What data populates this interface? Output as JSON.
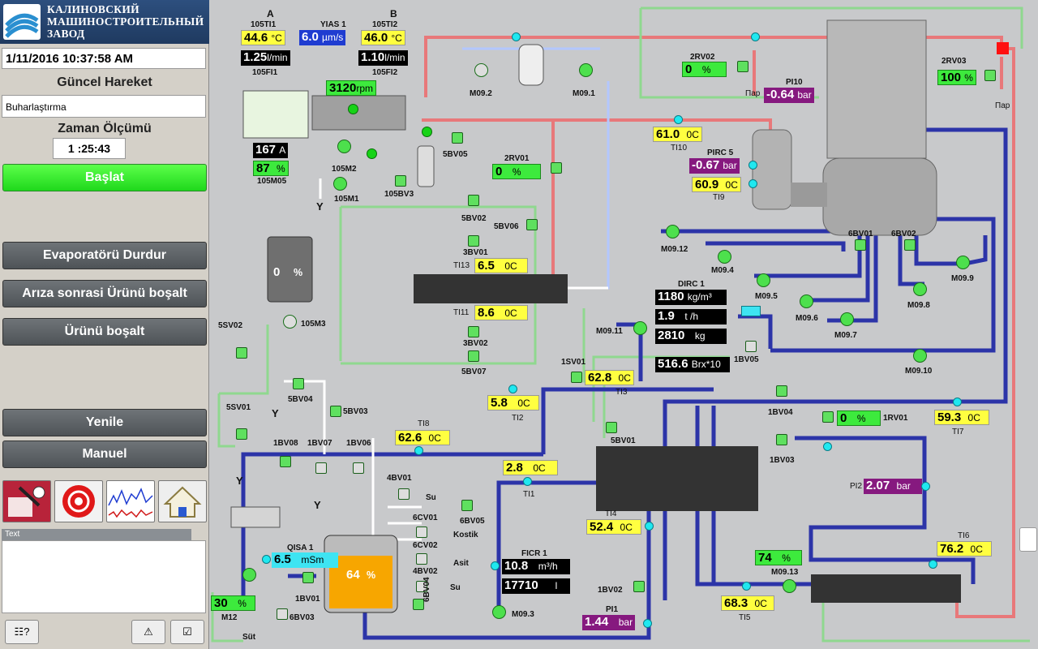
{
  "logo": {
    "line1": "КАЛИНОВСКИЙ",
    "line2": "МАШИНОСТРОИТЕЛЬНЫЙ",
    "line3": "ЗАВОД"
  },
  "sidebar": {
    "datetime": "1/11/2016 10:37:58 AM",
    "current_move_label": "Güncel Hareket",
    "current_move_value": "Buharlaştırma",
    "timer_label": "Zaman Ölçümü",
    "timer_value": "1  :25:43",
    "start_button": "Başlat",
    "stop_evap_button": "Evaporatörü Durdur",
    "empty_after_fault_button": "Arıza sonrasi Ürünü boşalt",
    "empty_product_button": "Ürünü boşalt",
    "refresh_button": "Yenile",
    "manual_button": "Manuel",
    "text_header": "Text",
    "tool_icons": [
      "operator-icon",
      "alarm-icon",
      "trend-icon",
      "home-icon"
    ]
  },
  "tags": {
    "A": "A",
    "B": "B",
    "ti1_label": "105TI1",
    "ti1_val": "44.6",
    "ti1_unit": "°C",
    "yias_label": "YIAS 1",
    "yias_val": "6.0",
    "yias_unit": "µm/s",
    "ti2_label": "105TI2",
    "ti2_val": "46.0",
    "ti2_unit": "°C",
    "fi1_val": "1.25",
    "fi1_unit": "l/min",
    "fi1_label": "105FI1",
    "fi2_val": "1.10",
    "fi2_unit": "l/min",
    "fi2_label": "105FI2",
    "rpm_val": "3120",
    "rpm_unit": "rpm",
    "amp_val": "167",
    "amp_unit": "A",
    "m05_val": "87",
    "m05_unit": "%",
    "m05_label": "105M05",
    "m2_label": "105M2",
    "m1_label": "105M1",
    "bv3_label": "105BV3",
    "bv05_label": "5BV05",
    "m092_label": "M09.2",
    "m091_label": "M09.1",
    "rv01_label": "2RV01",
    "rv01_val": "0",
    "rv01_unit": "%",
    "rv02_label": "2RV02",
    "rv02_val": "0",
    "rv02_unit": "%",
    "rv03_label": "2RV03",
    "rv03_val": "100",
    "rv03_unit": "%",
    "par1": "Пар",
    "par2": "Пар",
    "pi10_label": "PI10",
    "pi10_val": "-0.64",
    "pi10_unit": "bar",
    "ti10_val": "61.0",
    "ti10_unit": "0C",
    "ti10_label": "TI10",
    "pirc5_label": "PIRC 5",
    "pirc5_val": "-0.67",
    "pirc5_unit": "bar",
    "ti9_val": "60.9",
    "ti9_unit": "0C",
    "ti9_label": "TI9",
    "y1": "Y",
    "y2": "Y",
    "y3": "Y",
    "y4": "Y",
    "bv02_label": "5BV02",
    "bv06_label": "5BV06",
    "bv3_01": "3BV01",
    "ti13_label": "TI13",
    "ti13_val": "6.5",
    "ti13_unit": "0C",
    "ti11_label": "TI11",
    "ti11_val": "8.6",
    "ti11_unit": "0C",
    "bv3_02": "3BV02",
    "bv07_label": "5BV07",
    "tank_val": "0",
    "tank_unit": "%",
    "m3_label": "105M3",
    "sv02_label": "5SV02",
    "bv04_label": "5BV04",
    "bv03_label": "5BV03",
    "sv01_label": "5SV01",
    "m0912_label": "M09.12",
    "m094_label": "M09.4",
    "m095_label": "M09.5",
    "m096_label": "M09.6",
    "m097_label": "M09.7",
    "m098_label": "M09.8",
    "m099_label": "M09.9",
    "m0910_label": "M09.10",
    "m0911_label": "M09.11",
    "bv6_01": "6BV01",
    "bv6_02": "6BV02",
    "dirc_label": "DIRC 1",
    "dirc_dens": "1180",
    "dirc_dens_unit": "kg/m³",
    "dirc_flow": "1.9",
    "dirc_flow_unit": "t /h",
    "dirc_mass": "2810",
    "dirc_mass_unit": "kg",
    "brix_val": "516.6",
    "brix_unit": "Brx*10",
    "bv05_1": "1BV05",
    "sv1_label": "1SV01",
    "ti3_val": "62.8",
    "ti3_unit": "0C",
    "ti3_label": "TI3",
    "ti2b_val": "5.8",
    "ti2b_unit": "0C",
    "ti2b_label": "TI2",
    "ti8_label": "TI8",
    "ti8_val": "62.6",
    "ti8_unit": "0C",
    "bv08_label": "1BV08",
    "bv07b_label": "1BV07",
    "bv06b_label": "1BV06",
    "bv5_01": "5BV01",
    "ti1b_val": "2.8",
    "ti1b_unit": "0C",
    "ti1b_label": "TI1",
    "bv4_01": "4BV01",
    "su1": "Su",
    "bv6_05": "6BV05",
    "cv6_01": "6CV01",
    "kostik": "Kostik",
    "cv6_02": "6CV02",
    "asit": "Asit",
    "bv4_02": "4BV02",
    "su2": "Su",
    "bv6_04": "6BV04",
    "qisa_label": "QISA 1",
    "qisa_val": "6.5",
    "qisa_unit": "mSm",
    "bv01_label": "1BV01",
    "m12_val": "30",
    "m12_unit": "%",
    "m12_label": "M12",
    "bv6_03": "6BV03",
    "sut": "Süt",
    "big_tank_val": "64",
    "big_tank_unit": "%",
    "ficr_label": "FICR 1",
    "ficr_flow": "10.8",
    "ficr_flow_unit": "m³/h",
    "ficr_vol": "17710",
    "ficr_vol_unit": "l",
    "m093_label": "M09.3",
    "ti4_label": "TI4",
    "ti4_val": "52.4",
    "ti4_unit": "0C",
    "bv02_1": "1BV02",
    "pi1_label": "PI1",
    "pi1_val": "1.44",
    "pi1_unit": "bar",
    "bv04_1": "1BV04",
    "rv1_val": "0",
    "rv1_unit": "%",
    "rv1_label": "1RV01",
    "bv03_1": "1BV03",
    "ti7_val": "59.3",
    "ti7_unit": "0C",
    "ti7_label": "TI7",
    "pi2_label": "PI2",
    "pi2_val": "2.07",
    "pi2_unit": "bar",
    "ti6_label": "TI6",
    "ti6_val": "76.2",
    "ti6_unit": "0C",
    "m0913_val": "74",
    "m0913_unit": "%",
    "m0913_label": "M09.13",
    "ti5_val": "68.3",
    "ti5_unit": "0C",
    "ti5_label": "TI5"
  }
}
